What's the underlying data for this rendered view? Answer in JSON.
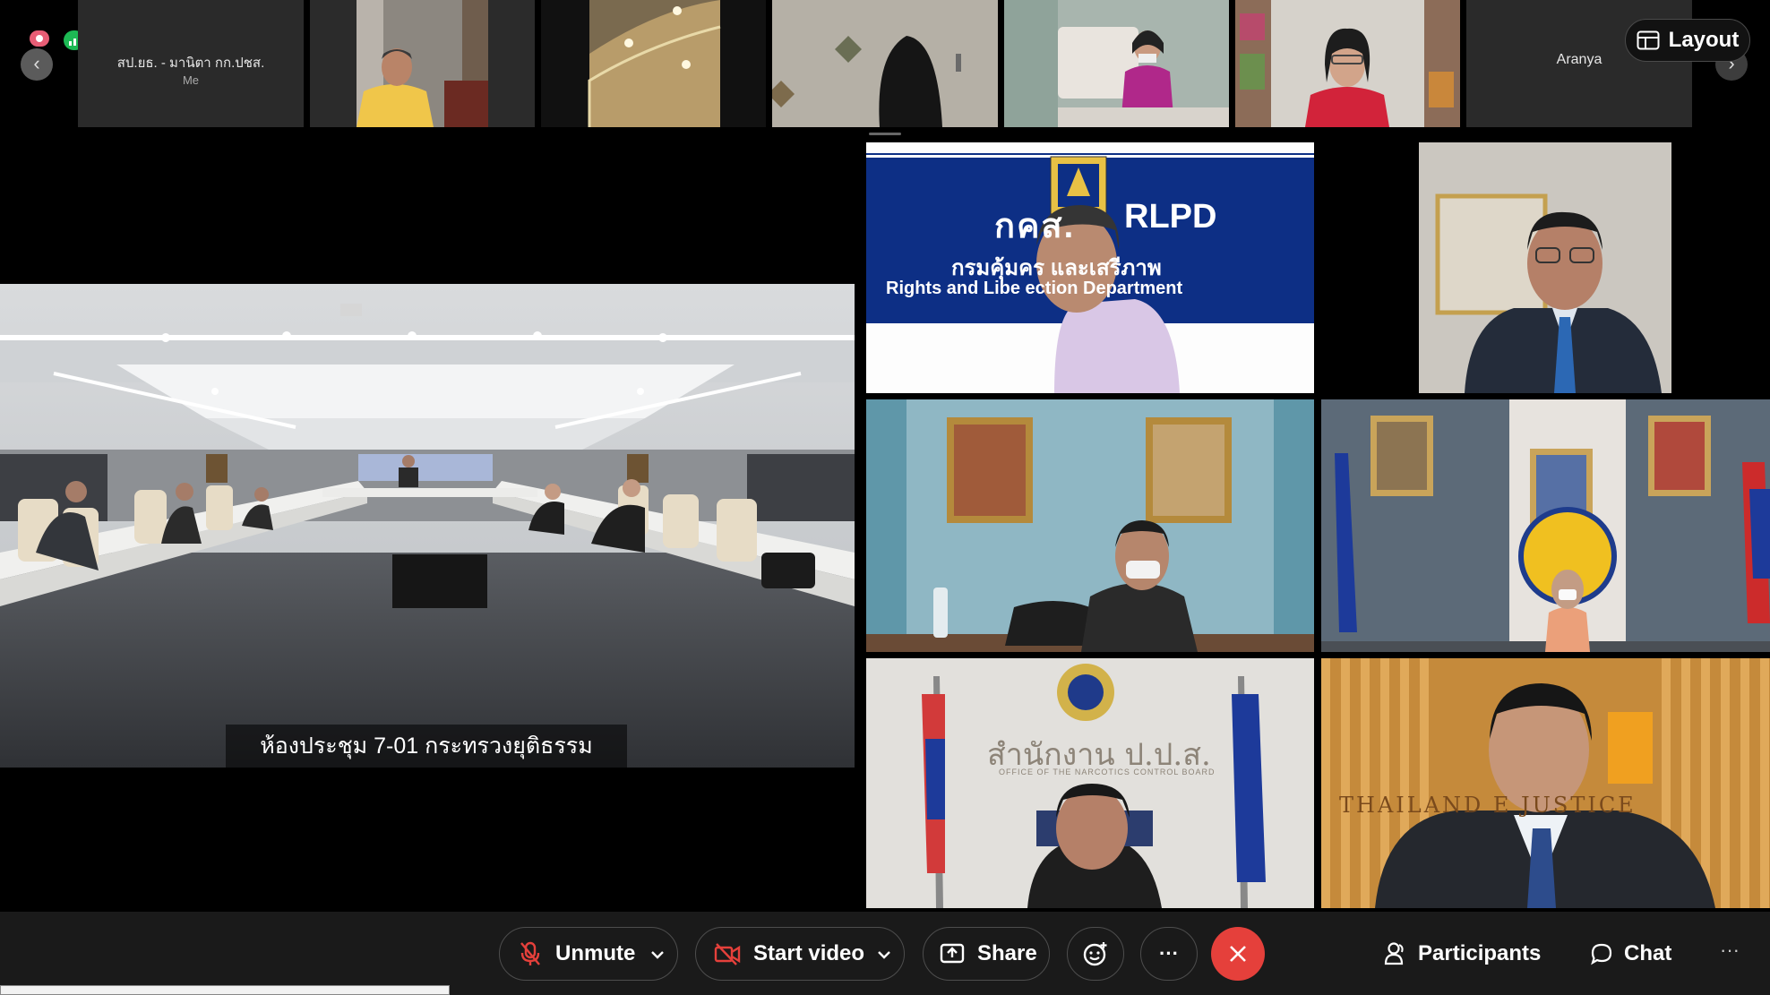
{
  "filmstrip": {
    "self_name": "สป.ยธ. - มานิตา กก.ปชส.",
    "self_tag": "Me",
    "right_name": "Aranya",
    "layout_label": "Layout"
  },
  "room": {
    "caption": "ห้องประชุม 7-01 กระทรวงยุติธรรม"
  },
  "grid": {
    "rlpd_thai_short": "กคส.",
    "rlpd_en_short": "RLPD",
    "rlpd_thai_name": "กรมคุ้มคร       และเสรีภาพ",
    "rlpd_en_name": "Rights and Libe             ection Department",
    "oncb_name": "สำนักงาน ป.ป.ส.",
    "oncb_sub": "OFFICE OF THE NARCOTICS CONTROL BOARD",
    "tij_wall": "THAILAND            E JUSTICE"
  },
  "toolbar": {
    "unmute": "Unmute",
    "start_video": "Start video",
    "share": "Share",
    "more": "···",
    "participants": "Participants",
    "chat": "Chat",
    "overflow": "···"
  },
  "colors": {
    "leave": "#e5403b",
    "record": "#e85d75",
    "signal": "#1db954",
    "rlpd_blue": "#0d2f85"
  }
}
